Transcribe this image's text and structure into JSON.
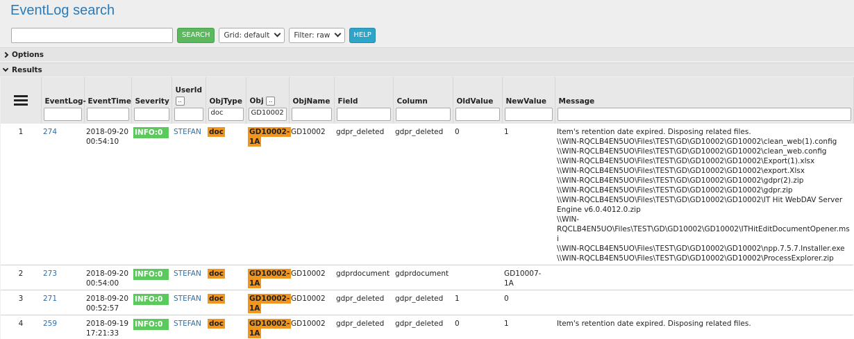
{
  "app": {
    "title": "EventLog search"
  },
  "toolbar": {
    "search_value": "",
    "search_label": "SEARCH",
    "grid_label": "Grid: default",
    "filter_label": "Filter: raw",
    "help_label": "HELP"
  },
  "sections": {
    "options": "Options",
    "results": "Results"
  },
  "columns": {
    "eventlog": "EventLog-",
    "eventtime": "EventTime",
    "severity": "Severity",
    "userid": "UserId",
    "objtype": "ObjType",
    "obj": "Obj",
    "objname": "ObjName",
    "field": "Field",
    "column": "Column",
    "oldvalue": "OldValue",
    "newvalue": "NewValue",
    "message": "Message",
    "dots": ".."
  },
  "filters": {
    "objtype": "doc",
    "obj": "GD10002"
  },
  "rows": [
    {
      "num": "1",
      "eventlog": "274",
      "time1": "2018-09-20",
      "time2": "00:54:10",
      "severity": "INFO:0",
      "userid": "STEFAN",
      "objtype": "doc",
      "obj1": "GD10002-",
      "obj2": "1A",
      "objname": "GD10002",
      "field": "gdpr_deleted",
      "column": "gdpr_deleted",
      "oldvalue": "0",
      "newvalue1": "1",
      "newvalue2": "",
      "message": [
        "Item's retention date expired. Disposing related files.",
        "\\\\WIN-RQCLB4EN5UO\\Files\\TEST\\GD\\GD10002\\GD10002\\clean_web(1).config",
        "\\\\WIN-RQCLB4EN5UO\\Files\\TEST\\GD\\GD10002\\GD10002\\clean_web.config",
        "\\\\WIN-RQCLB4EN5UO\\Files\\TEST\\GD\\GD10002\\GD10002\\Export(1).xlsx",
        "\\\\WIN-RQCLB4EN5UO\\Files\\TEST\\GD\\GD10002\\GD10002\\export.Xlsx",
        "\\\\WIN-RQCLB4EN5UO\\Files\\TEST\\GD\\GD10002\\GD10002\\gdpr(2).zip",
        "\\\\WIN-RQCLB4EN5UO\\Files\\TEST\\GD\\GD10002\\GD10002\\gdpr.zip",
        "\\\\WIN-RQCLB4EN5UO\\Files\\TEST\\GD\\GD10002\\GD10002\\IT Hit WebDAV Server",
        "Engine v6.0.4012.0.zip",
        "\\\\WIN-",
        "RQCLB4EN5UO\\Files\\TEST\\GD\\GD10002\\GD10002\\ITHitEditDocumentOpener.msi",
        "\\\\WIN-RQCLB4EN5UO\\Files\\TEST\\GD\\GD10002\\GD10002\\npp.7.5.7.Installer.exe",
        "\\\\WIN-RQCLB4EN5UO\\Files\\TEST\\GD\\GD10002\\GD10002\\ProcessExplorer.zip"
      ]
    },
    {
      "num": "2",
      "eventlog": "273",
      "time1": "2018-09-20",
      "time2": "00:54:00",
      "severity": "INFO:0",
      "userid": "STEFAN",
      "objtype": "doc",
      "obj1": "GD10002-",
      "obj2": "1A",
      "objname": "GD10002",
      "field": "gdprdocument",
      "column": "gdprdocument",
      "oldvalue": "",
      "newvalue1": "GD10007-",
      "newvalue2": "1A",
      "message": []
    },
    {
      "num": "3",
      "eventlog": "271",
      "time1": "2018-09-20",
      "time2": "00:52:57",
      "severity": "INFO:0",
      "userid": "STEFAN",
      "objtype": "doc",
      "obj1": "GD10002-",
      "obj2": "1A",
      "objname": "GD10002",
      "field": "gdpr_deleted",
      "column": "gdpr_deleted",
      "oldvalue": "1",
      "newvalue1": "0",
      "newvalue2": "",
      "message": []
    },
    {
      "num": "4",
      "eventlog": "259",
      "time1": "2018-09-19",
      "time2": "17:21:33",
      "severity": "INFO:0",
      "userid": "STEFAN",
      "objtype": "doc",
      "obj1": "GD10002-",
      "obj2": "1A",
      "objname": "GD10002",
      "field": "gdpr_deleted",
      "column": "gdpr_deleted",
      "oldvalue": "0",
      "newvalue1": "1",
      "newvalue2": "",
      "message": [
        "Item's retention date expired. Disposing related files."
      ]
    }
  ],
  "colors": {
    "info": "#5cc95c",
    "doc": "#f0961e",
    "link": "#2e6ea6",
    "title": "#2a7ab8"
  }
}
